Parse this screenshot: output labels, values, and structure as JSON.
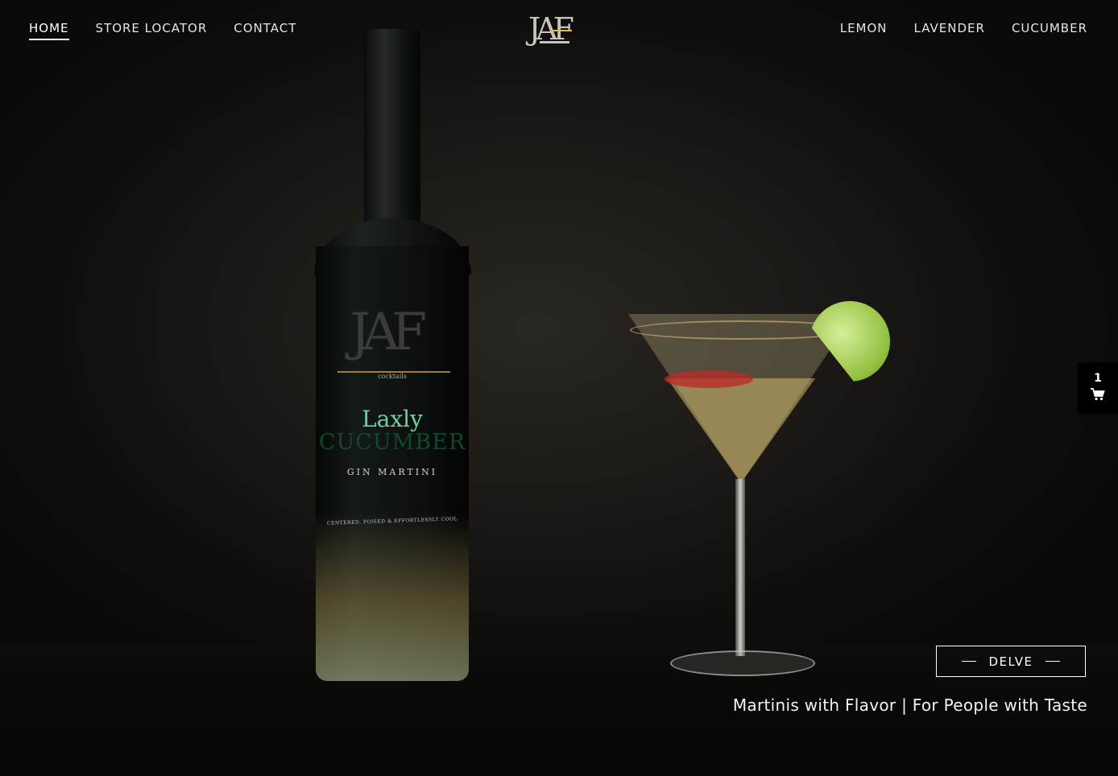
{
  "nav": {
    "left": [
      {
        "label": "HOME",
        "active": true
      },
      {
        "label": "STORE LOCATOR"
      },
      {
        "label": "CONTACT"
      }
    ],
    "right": [
      {
        "label": "LEMON"
      },
      {
        "label": "LAVENDER"
      },
      {
        "label": "CUCUMBER"
      }
    ]
  },
  "logo": {
    "text": "JAF"
  },
  "bottle_label": {
    "logo": "JAF",
    "small": "cocktails",
    "name_top": "Laxly",
    "name_bottom": "CUCUMBER",
    "type": "GIN MARTINI",
    "motto": "CENTERED, POISED & EFFORTLESSLY COOL"
  },
  "cart": {
    "count": "1",
    "icon": "cart-icon"
  },
  "hero": {
    "cta_label": "DELVE",
    "tagline": "Martinis with Flavor | For People with Taste"
  },
  "colors": {
    "accent": "#d9c23a",
    "background": "#0c0b0a",
    "text": "#ffffff"
  }
}
